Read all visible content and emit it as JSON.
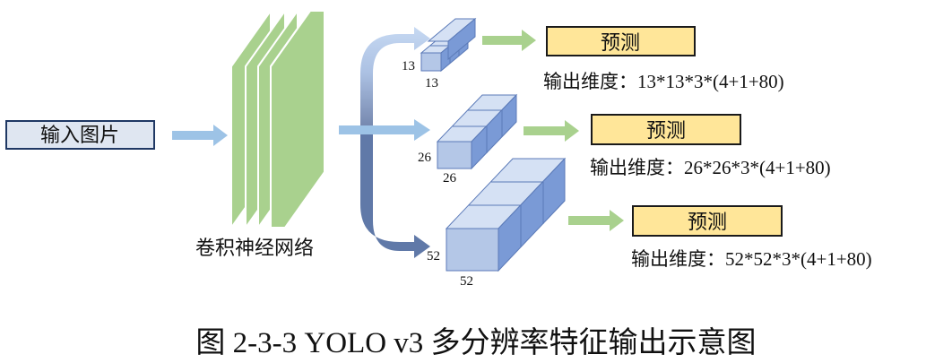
{
  "input_label": "输入图片",
  "cnn_label": "卷积神经网络",
  "scales": [
    {
      "size": "13",
      "size_bottom": "13",
      "predict": "预测",
      "output": "输出维度：13*13*3*(4+1+80)"
    },
    {
      "size": "26",
      "size_bottom": "26",
      "predict": "预测",
      "output": "输出维度：26*26*3*(4+1+80)"
    },
    {
      "size": "52",
      "size_bottom": "52",
      "predict": "预测",
      "output": "输出维度：52*52*3*(4+1+80)"
    }
  ],
  "caption": "图 2-3-3 YOLO v3 多分辨率特征输出示意图",
  "colors": {
    "input_box_fill": "#dfe6f1",
    "input_box_stroke": "#1f3864",
    "cnn_layer": "#a9d18e",
    "cnn_layer_stroke": "#ffffff",
    "predict_fill": "#ffe699",
    "predict_stroke": "#1a1a1a",
    "arrow_light_blue": "#9dc3e6",
    "arrow_dark_blue": "#6079a8",
    "arrow_green": "#a9d18e",
    "cube_front": "#b4c7e7",
    "cube_top": "#d5e1f4",
    "cube_side": "#7a9ad6"
  }
}
